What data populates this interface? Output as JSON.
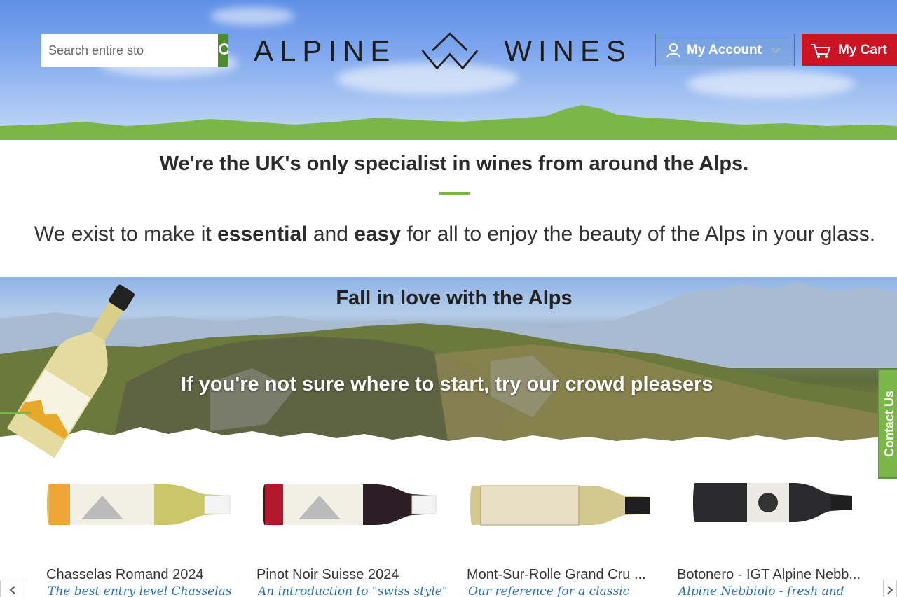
{
  "header": {
    "search": {
      "placeholder": "Search entire sto",
      "value": ""
    },
    "logo": {
      "left_word": "ALPINE",
      "right_word": "WINES"
    },
    "account_label": "My Account",
    "cart_label": "My Cart",
    "colors": {
      "search_button": "#4e8b2c",
      "cart": "#cc1324",
      "hills": "#7ab648"
    }
  },
  "intro": {
    "headline": "We're the UK's only specialist in wines from around the Alps.",
    "mission_parts": [
      "We exist to make it ",
      "essential",
      " and ",
      "easy",
      " for all to enjoy the beauty of the Alps in your glass."
    ]
  },
  "hero": {
    "title": "Fall in love with the Alps",
    "subtitle": "If you're not sure where to start, try our crowd pleasers"
  },
  "contact_tab": "Contact Us",
  "products": [
    {
      "name": "Chasselas Romand 2024",
      "tagline": "The best entry level Chasselas"
    },
    {
      "name": "Pinot Noir Suisse 2024",
      "tagline": "An introduction to \"swiss style\""
    },
    {
      "name": "Mont-Sur-Rolle Grand Cru ...",
      "tagline": "Our reference for a classic"
    },
    {
      "name": "Botonero - IGT Alpine Nebb...",
      "tagline": "Alpine Nebbiolo - fresh and"
    }
  ]
}
